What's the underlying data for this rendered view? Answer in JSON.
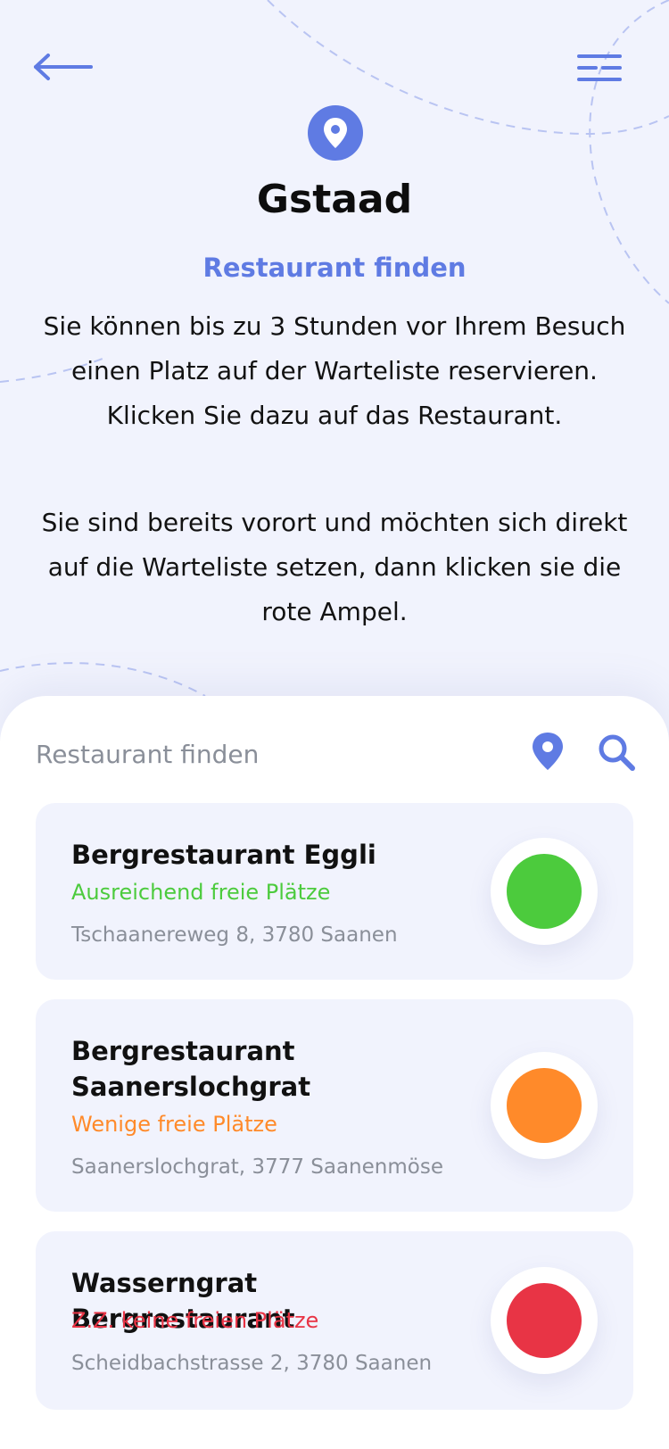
{
  "colors": {
    "accent": "#5f7be3",
    "background": "#f1f3fd",
    "green": "#4ccb3d",
    "orange": "#ff8a2a",
    "red": "#e83445"
  },
  "icons": {
    "back": "arrow-left-icon",
    "menu": "menu-icon",
    "location": "map-pin-icon",
    "search": "search-icon"
  },
  "header": {
    "city": "Gstaad",
    "subtitle": "Restaurant finden",
    "intro_1": "Sie können bis zu 3 Stunden vor Ihrem Besuch einen Platz auf der Warteliste reservieren. Klicken Sie dazu auf das Restaurant.",
    "intro_2": "Sie sind bereits vorort und möchten sich direkt auf die Warteliste setzen, dann klicken sie die rote Ampel."
  },
  "search": {
    "placeholder": "Restaurant finden",
    "value": ""
  },
  "restaurants": [
    {
      "name": "Bergrestaurant Eggli",
      "status": "Ausreichend freie Plätze",
      "status_level": "green",
      "status_color": "#4ccb3d",
      "address": "Tschaanereweg 8, 3780 Saanen"
    },
    {
      "name": "Bergrestaurant Saanerslochgrat",
      "status": "Wenige freie Plätze",
      "status_level": "orange",
      "status_color": "#ff8a2a",
      "address": "Saanerslochgrat, 3777 Saanenmöse"
    },
    {
      "name": "Wasserngrat Bergrestaurant",
      "status": "Z.Z. keine freien Plätze",
      "status_level": "red",
      "status_color": "#e83445",
      "address": "Scheidbachstrasse 2, 3780 Saanen"
    }
  ]
}
